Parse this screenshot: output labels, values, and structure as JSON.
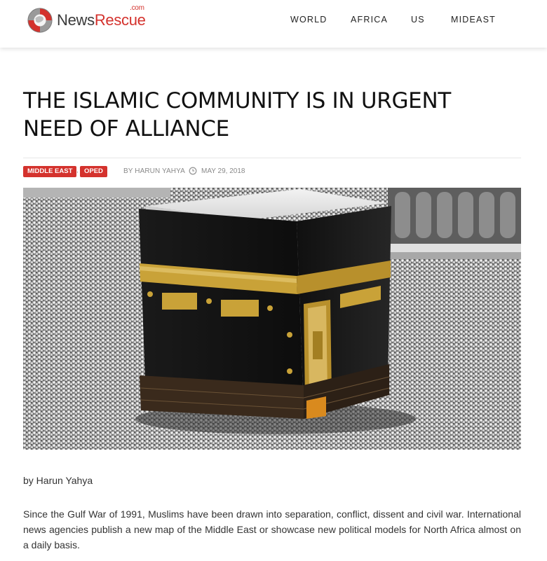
{
  "site": {
    "logo_news": "News",
    "logo_rescue": "Rescue",
    "logo_com": ".com"
  },
  "nav": {
    "items": [
      {
        "label": "WORLD"
      },
      {
        "label": "AFRICA"
      },
      {
        "label": "US"
      },
      {
        "label": "MIDEAST"
      }
    ]
  },
  "article": {
    "title": "THE ISLAMIC COMMUNITY IS IN URGENT NEED OF ALLIANCE",
    "tags": [
      {
        "label": "MIDDLE EAST"
      },
      {
        "label": "OPED"
      }
    ],
    "tag_separator": ",",
    "byline_prefix": "BY",
    "author": "HARUN YAHYA",
    "date": "MAY 29, 2018",
    "image_icon": "kaaba-photo",
    "body_byline": "by Harun Yahya",
    "paragraph_1": "Since the Gulf War of 1991, Muslims have been drawn into separation, conflict, dissent and civil war. International news agencies publish a new map of the Middle East or showcase new political models for North Africa almost on a daily basis."
  },
  "colors": {
    "brand_red": "#d4322d",
    "meta_gray": "#8a8a8a",
    "kaaba_gold": "#c9a238"
  },
  "icons": {
    "logo": "globe-lifebuoy-icon",
    "date": "clock-icon"
  }
}
